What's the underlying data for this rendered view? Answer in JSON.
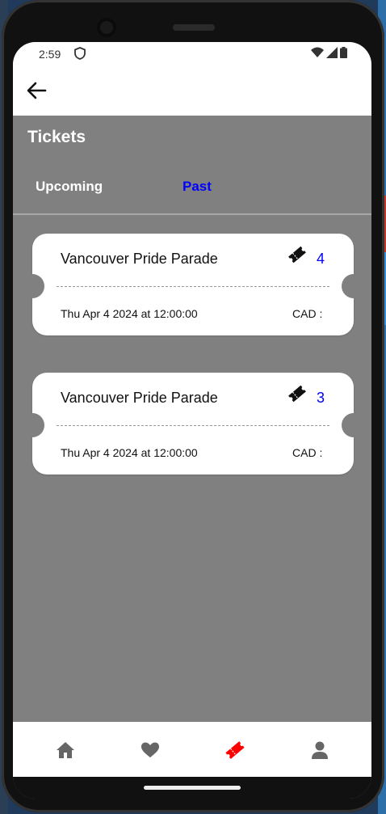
{
  "status": {
    "time": "2:59"
  },
  "page": {
    "title": "Tickets"
  },
  "tabs": [
    {
      "label": "Upcoming",
      "active": false
    },
    {
      "label": "Past",
      "active": true
    }
  ],
  "tickets": [
    {
      "title": "Vancouver Pride Parade",
      "count": "4",
      "date": "Thu Apr 4 2024 at 12:00:00",
      "price_label": "CAD :"
    },
    {
      "title": "Vancouver Pride Parade",
      "count": "3",
      "date": "Thu Apr 4 2024 at 12:00:00",
      "price_label": "CAD :"
    }
  ],
  "nav": {
    "items": [
      {
        "icon": "home-icon",
        "active": false
      },
      {
        "icon": "heart-icon",
        "active": false
      },
      {
        "icon": "ticket-icon",
        "active": true
      },
      {
        "icon": "person-icon",
        "active": false
      }
    ]
  },
  "colors": {
    "accent": "#0000ff",
    "active_nav": "#ff0000",
    "background": "#808080"
  }
}
